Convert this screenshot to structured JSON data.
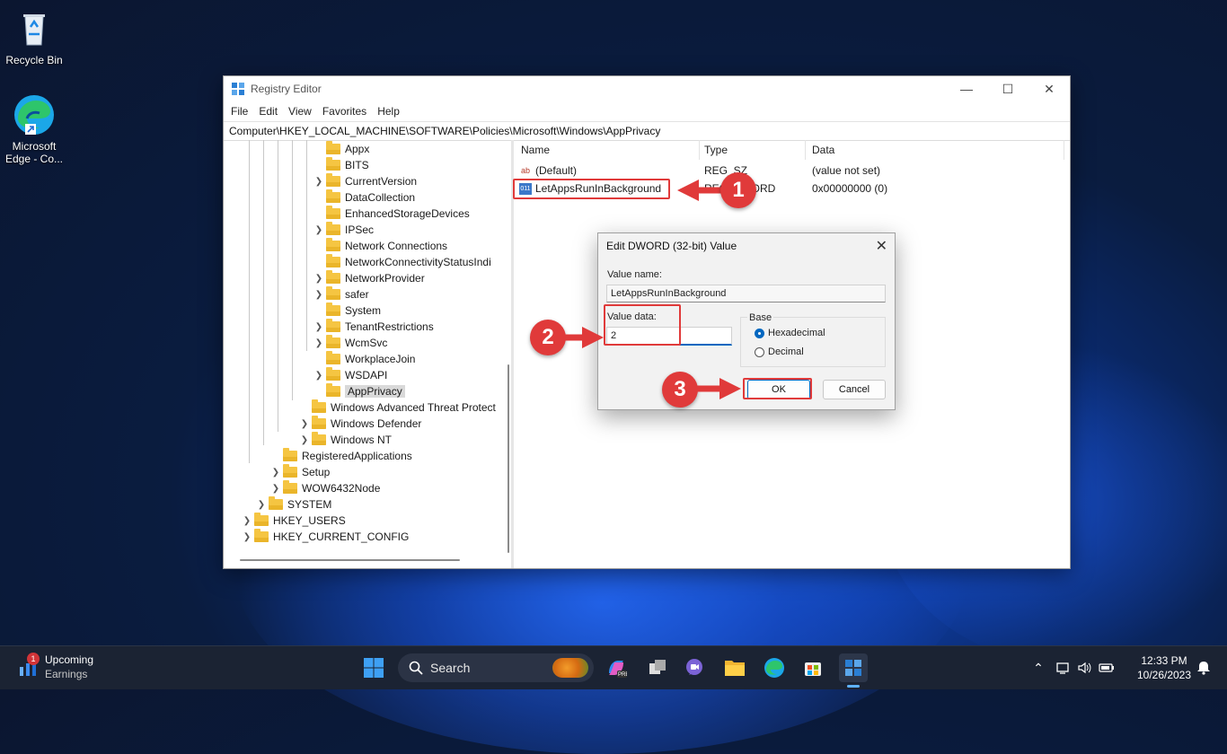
{
  "desktop": {
    "icons": [
      {
        "label": "Recycle Bin"
      },
      {
        "label": "Microsoft Edge - Co..."
      }
    ]
  },
  "window": {
    "title": "Registry Editor",
    "menu": [
      "File",
      "Edit",
      "View",
      "Favorites",
      "Help"
    ],
    "address": "Computer\\HKEY_LOCAL_MACHINE\\SOFTWARE\\Policies\\Microsoft\\Windows\\AppPrivacy",
    "tree": [
      {
        "label": "Appx",
        "expandable": false
      },
      {
        "label": "BITS",
        "expandable": false
      },
      {
        "label": "CurrentVersion",
        "expandable": true
      },
      {
        "label": "DataCollection",
        "expandable": false
      },
      {
        "label": "EnhancedStorageDevices",
        "expandable": false
      },
      {
        "label": "IPSec",
        "expandable": true
      },
      {
        "label": "Network Connections",
        "expandable": false
      },
      {
        "label": "NetworkConnectivityStatusIndi",
        "expandable": false
      },
      {
        "label": "NetworkProvider",
        "expandable": true
      },
      {
        "label": "safer",
        "expandable": true
      },
      {
        "label": "System",
        "expandable": false
      },
      {
        "label": "TenantRestrictions",
        "expandable": true
      },
      {
        "label": "WcmSvc",
        "expandable": true
      },
      {
        "label": "WorkplaceJoin",
        "expandable": false
      },
      {
        "label": "WSDAPI",
        "expandable": true
      },
      {
        "label": "AppPrivacy",
        "expandable": false,
        "selected": true
      },
      {
        "label": "Windows Advanced Threat Protect",
        "expandable": false
      },
      {
        "label": "Windows Defender",
        "expandable": true
      },
      {
        "label": "Windows NT",
        "expandable": true
      },
      {
        "label": "RegisteredApplications",
        "expandable": false
      },
      {
        "label": "Setup",
        "expandable": true
      },
      {
        "label": "WOW6432Node",
        "expandable": true
      },
      {
        "label": "SYSTEM",
        "expandable": true
      },
      {
        "label": "HKEY_USERS",
        "expandable": true
      },
      {
        "label": "HKEY_CURRENT_CONFIG",
        "expandable": true
      }
    ],
    "columns": {
      "name": "Name",
      "type": "Type",
      "data": "Data"
    },
    "values": [
      {
        "name": "(Default)",
        "type": "REG_SZ",
        "data": "(value not set)",
        "icon": "string-value-icon"
      },
      {
        "name": "LetAppsRunInBackground",
        "type": "REG_DWORD",
        "data": "0x00000000 (0)",
        "icon": "dword-value-icon"
      }
    ]
  },
  "dialog": {
    "title": "Edit DWORD (32-bit) Value",
    "value_name_label": "Value name:",
    "value_name": "LetAppsRunInBackground",
    "value_data_label": "Value data:",
    "value_data": "2",
    "base_label": "Base",
    "radio_hex": "Hexadecimal",
    "radio_dec": "Decimal",
    "base_selected": "Hexadecimal",
    "ok": "OK",
    "cancel": "Cancel"
  },
  "annotations": {
    "step1": "1",
    "step2": "2",
    "step3": "3",
    "color": "#e03a3a"
  },
  "taskbar": {
    "widget_badge": "1",
    "widget_title": "Upcoming",
    "widget_subtitle": "Earnings",
    "search_label": "Search",
    "time": "12:33 PM",
    "date": "10/26/2023"
  }
}
